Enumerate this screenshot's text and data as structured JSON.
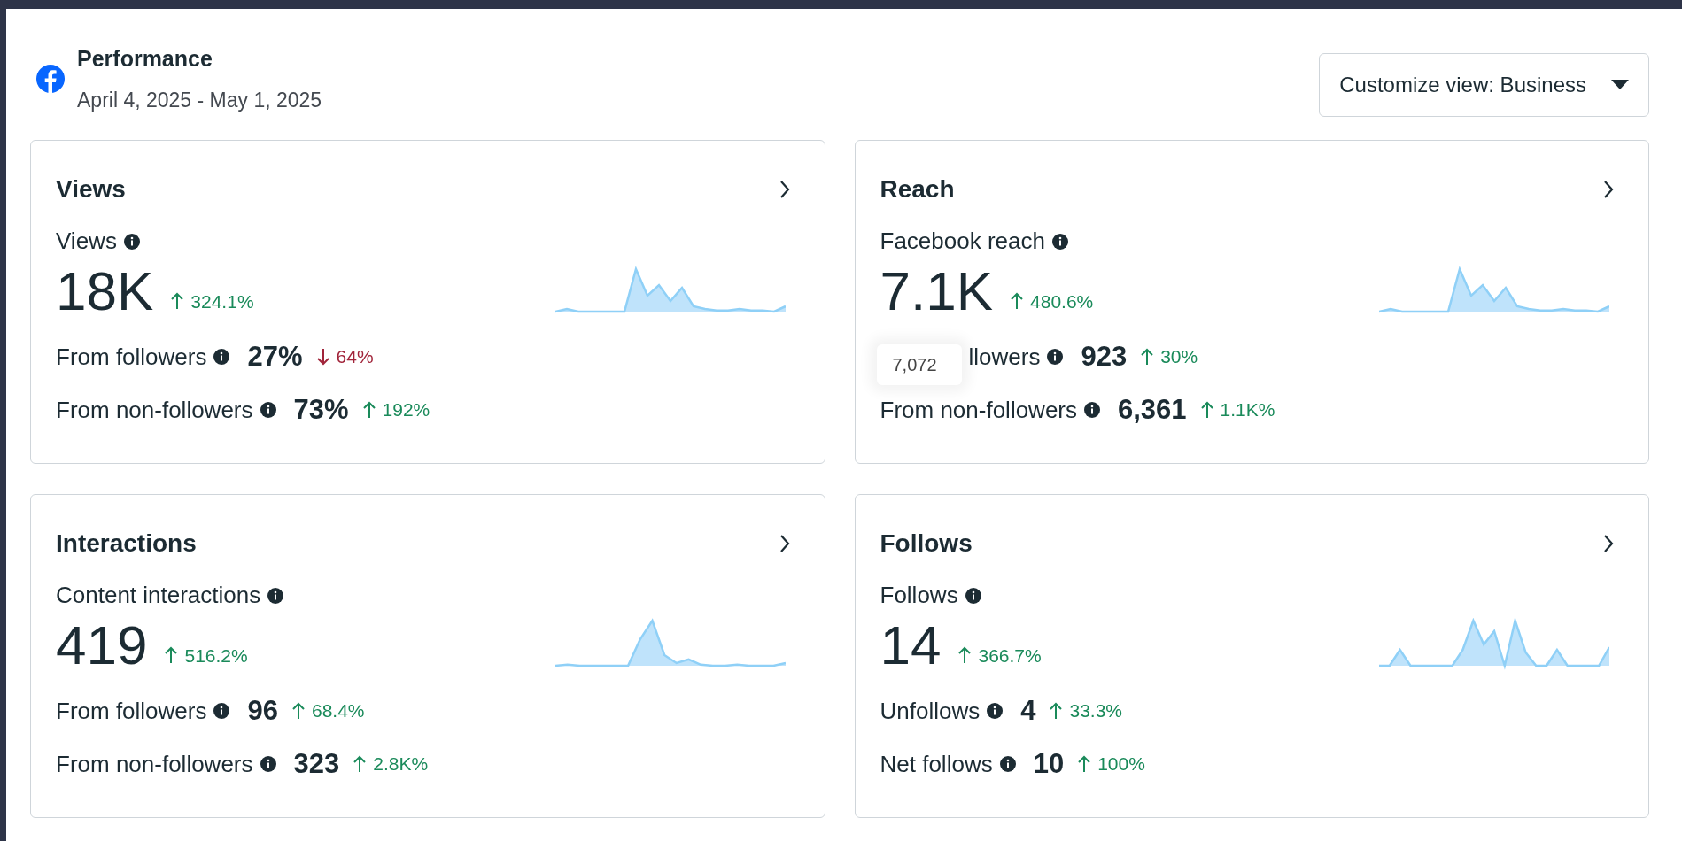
{
  "header": {
    "title": "Performance",
    "date_range": "April 4, 2025 - May 1, 2025"
  },
  "customize_button": {
    "label": "Customize view: Business"
  },
  "cards": [
    {
      "title": "Views",
      "metric": "Views",
      "value": "18K",
      "change": {
        "increase": true,
        "text": "324.1%"
      },
      "rows": [
        {
          "label": "From followers",
          "value": "27%",
          "change": {
            "increase": false,
            "text": "64%"
          }
        },
        {
          "label": "From non-followers",
          "value": "73%",
          "change": {
            "increase": true,
            "text": "192%"
          }
        }
      ]
    },
    {
      "title": "Reach",
      "metric": "Facebook reach",
      "value": "7.1K",
      "change": {
        "increase": true,
        "text": "480.6%"
      },
      "rows": [
        {
          "tooltip": "7,072",
          "label": "llowers",
          "value": "923",
          "change": {
            "increase": true,
            "text": "30%"
          }
        },
        {
          "label": "From non-followers",
          "value": "6,361",
          "change": {
            "increase": true,
            "text": "1.1K%"
          }
        }
      ]
    },
    {
      "title": "Interactions",
      "metric": "Content interactions",
      "value": "419",
      "change": {
        "increase": true,
        "text": "516.2%"
      },
      "rows": [
        {
          "label": "From followers",
          "value": "96",
          "change": {
            "increase": true,
            "text": "68.4%"
          }
        },
        {
          "label": "From non-followers",
          "value": "323",
          "change": {
            "increase": true,
            "text": "2.8K%"
          }
        }
      ]
    },
    {
      "title": "Follows",
      "metric": "Follows",
      "value": "14",
      "change": {
        "increase": true,
        "text": "366.7%"
      },
      "rows": [
        {
          "label": "Unfollows",
          "value": "4",
          "change": {
            "increase": true,
            "text": "33.3%"
          }
        },
        {
          "label": "Net follows",
          "value": "10",
          "change": {
            "increase": true,
            "text": "100%"
          }
        }
      ]
    }
  ]
}
